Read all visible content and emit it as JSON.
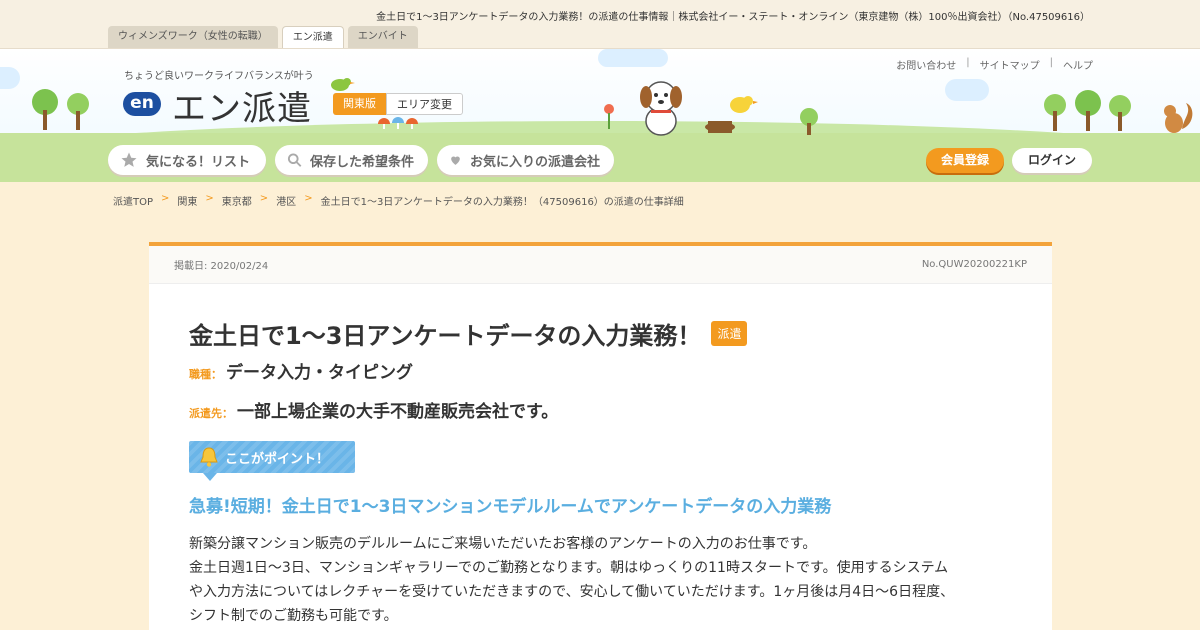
{
  "page_heading": "金土日で1～3日アンケートデータの入力業務！の派遣の仕事情報｜株式会社イー・ステート・オンライン（東京建物（株）100％出資会社）（No.47509616）",
  "site_tabs": [
    "ウィメンズワーク（女性の転職）",
    "エン派遣",
    "エンバイト"
  ],
  "tagline": "ちょうど良いワークライフバランスが叶う",
  "logo": {
    "mark": "en",
    "text": "エン派遣"
  },
  "region": {
    "current": "関東版",
    "change": "エリア変更"
  },
  "util_links": [
    "お問い合わせ",
    "サイトマップ",
    "ヘルプ"
  ],
  "nav": {
    "favorites": "気になる！リスト",
    "saved_search": "保存した希望条件",
    "favorite_agencies": "お気に入りの派遣会社"
  },
  "auth": {
    "register": "会員登録",
    "login": "ログイン"
  },
  "breadcrumb": [
    "派遣TOP",
    "関東",
    "東京都",
    "港区",
    "金土日で1～3日アンケートデータの入力業務！（47509616）の派遣の仕事詳細"
  ],
  "job": {
    "posted": "掲載日: 2020/02/24",
    "number": "No.QUW20200221KP",
    "title": "金土日で1～3日アンケートデータの入力業務！",
    "badge": "派遣",
    "type_label": "職種：",
    "type_value": "データ入力・タイピング",
    "dest_label": "派遣先：",
    "dest_value": "一部上場企業の大手不動産販売会社です。",
    "point_label": "ここがポイント！",
    "catch": "急募!短期！金土日で1～3日マンションモデルルームでアンケートデータの入力業務",
    "description": [
      "新築分譲マンション販売のデルルームにご来場いただいたお客様のアンケートの入力のお仕事です。",
      "金土日週1日～3日、マンションギャラリーでのご勤務となります。朝はゆっくりの11時スタートです。使用するシステム",
      "や入力方法についてはレクチャーを受けていただきますので、安心して働いていただけます。1ヶ月後は月4日～6日程度、",
      "シフト制でのご勤務も可能です。"
    ]
  },
  "colors": {
    "accent": "#f39a1f",
    "point_blue": "#6ab5e8",
    "background": "#fdf0d6"
  }
}
